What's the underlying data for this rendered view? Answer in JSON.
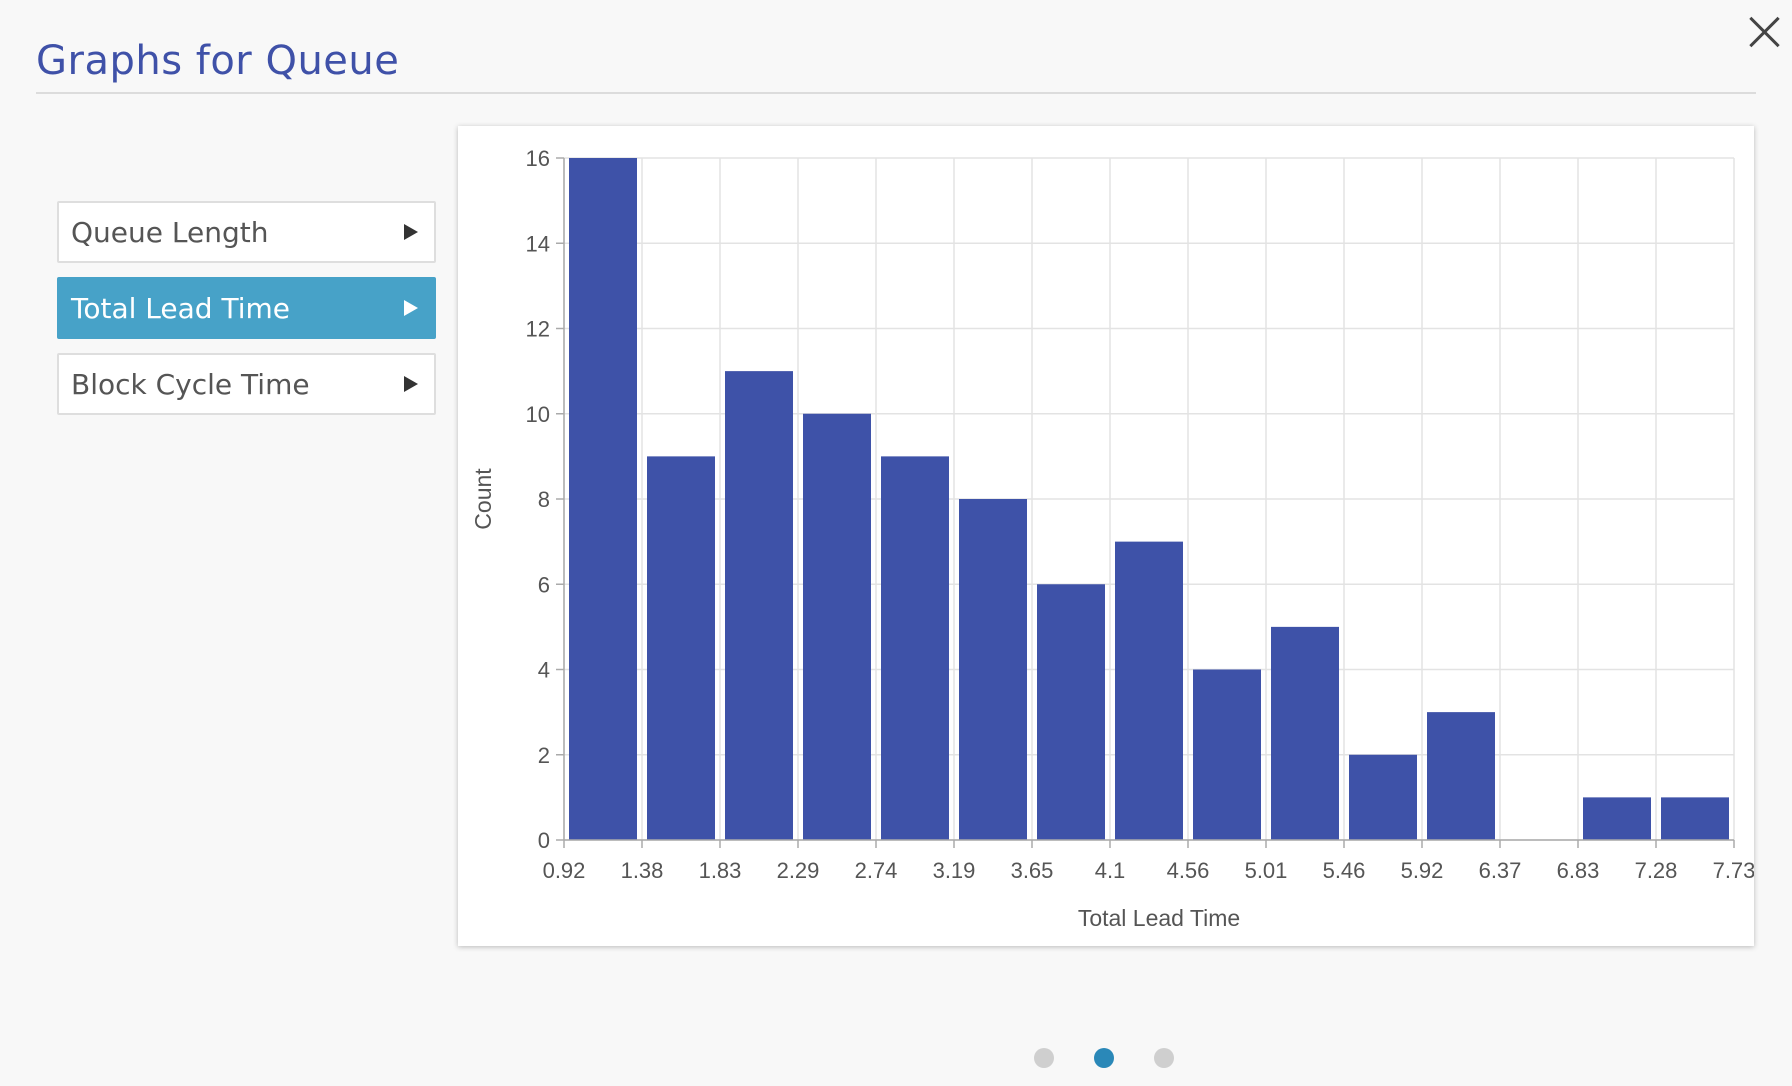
{
  "header": {
    "title": "Graphs for Queue"
  },
  "menu": {
    "items": [
      {
        "label": "Queue Length",
        "active": false
      },
      {
        "label": "Total Lead Time",
        "active": true
      },
      {
        "label": "Block Cycle Time",
        "active": false
      }
    ]
  },
  "chart_data": {
    "type": "bar",
    "title": "",
    "xlabel": "Total Lead Time",
    "ylabel": "Count",
    "ylim": [
      0,
      16
    ],
    "yticks": [
      0,
      2,
      4,
      6,
      8,
      10,
      12,
      14,
      16
    ],
    "bin_edges": [
      "0.92",
      "1.38",
      "1.83",
      "2.29",
      "2.74",
      "3.19",
      "3.65",
      "4.1",
      "4.56",
      "5.01",
      "5.46",
      "5.92",
      "6.37",
      "6.83",
      "7.28",
      "7.73"
    ],
    "values": [
      16,
      9,
      11,
      10,
      9,
      8,
      6,
      7,
      4,
      5,
      2,
      3,
      0,
      1,
      1
    ],
    "bar_color": "#3e52a8",
    "grid": true
  },
  "pagination": {
    "count": 3,
    "active_index": 1
  },
  "colors": {
    "accent": "#47a2c8",
    "title": "#3f51a8",
    "bar": "#3e52a8",
    "active_dot": "#2a88b8"
  }
}
